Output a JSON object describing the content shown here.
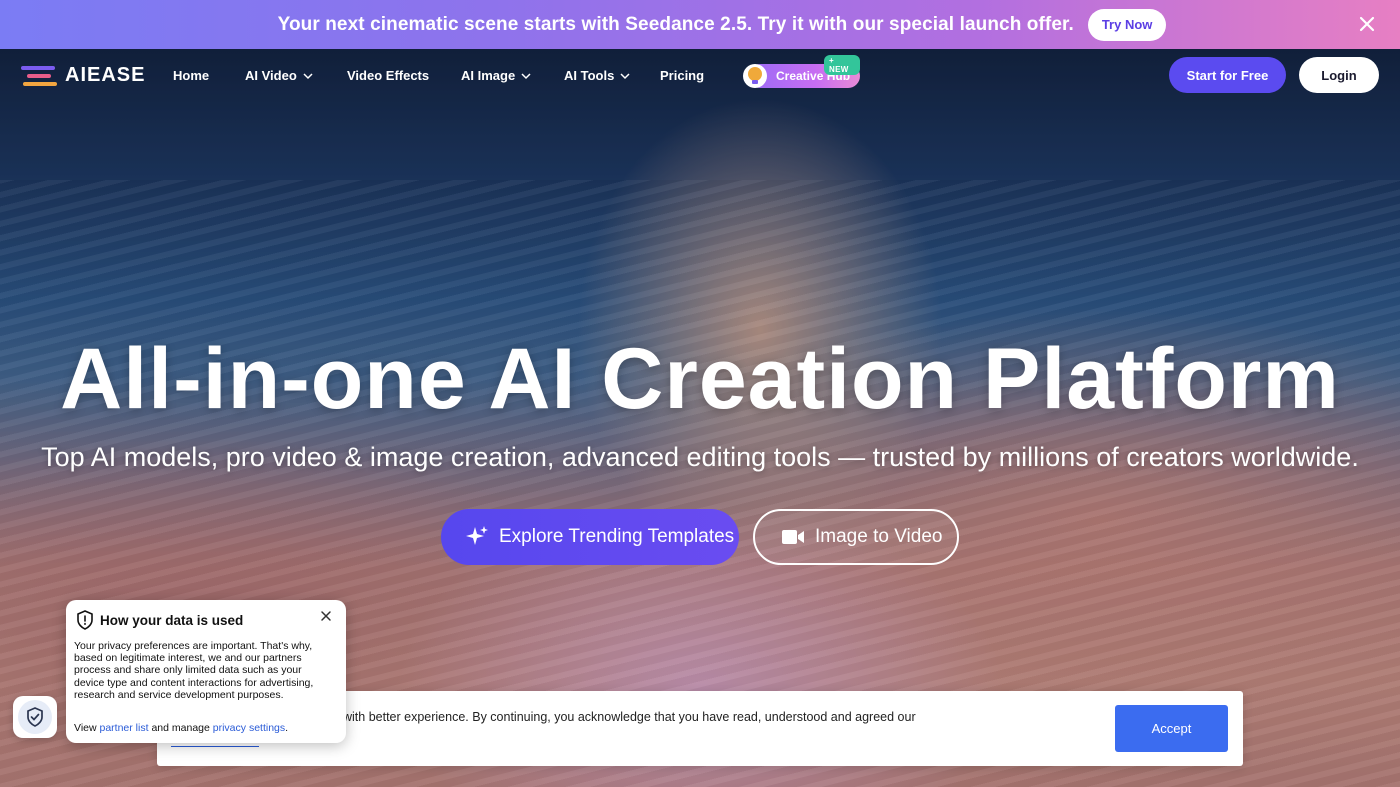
{
  "promo": {
    "text": "Your next cinematic scene starts with Seedance 2.5. Try it with our special launch offer.",
    "button_label": "Try Now"
  },
  "nav": {
    "brand": "AIEASE",
    "links": [
      "Home",
      "AI Video",
      "Video Effects",
      "AI Image",
      "AI Tools",
      "Pricing"
    ],
    "creative_hub": "Creative Hub",
    "new_badge": "+ NEW",
    "start_label": "Start for Free",
    "login_label": "Login"
  },
  "hero": {
    "headline": "All-in-one AI Creation Platform",
    "subline": "Top AI models, pro video & image creation, advanced editing tools — trusted by millions of creators worldwide.",
    "cta_primary": "Explore Trending Templates",
    "cta_secondary": "Image to Video"
  },
  "cookie": {
    "text": "with better experience. By continuing, you acknowledge that you have read, understood and agreed our",
    "accept_label": "Accept"
  },
  "privacy": {
    "title": "How your data is used",
    "body": "Your privacy preferences are important. That's why, based on legitimate interest, we and our partners process and share only limited data such as your device type and content interactions for advertising, research and service development purposes.",
    "view": "View",
    "partner_list": "partner list",
    "and_manage": "and manage",
    "privacy_settings": "privacy settings",
    "period": "."
  },
  "colors": {
    "accent": "#5b4bf0",
    "accept": "#3b6cf0",
    "link": "#2a5bd7"
  }
}
